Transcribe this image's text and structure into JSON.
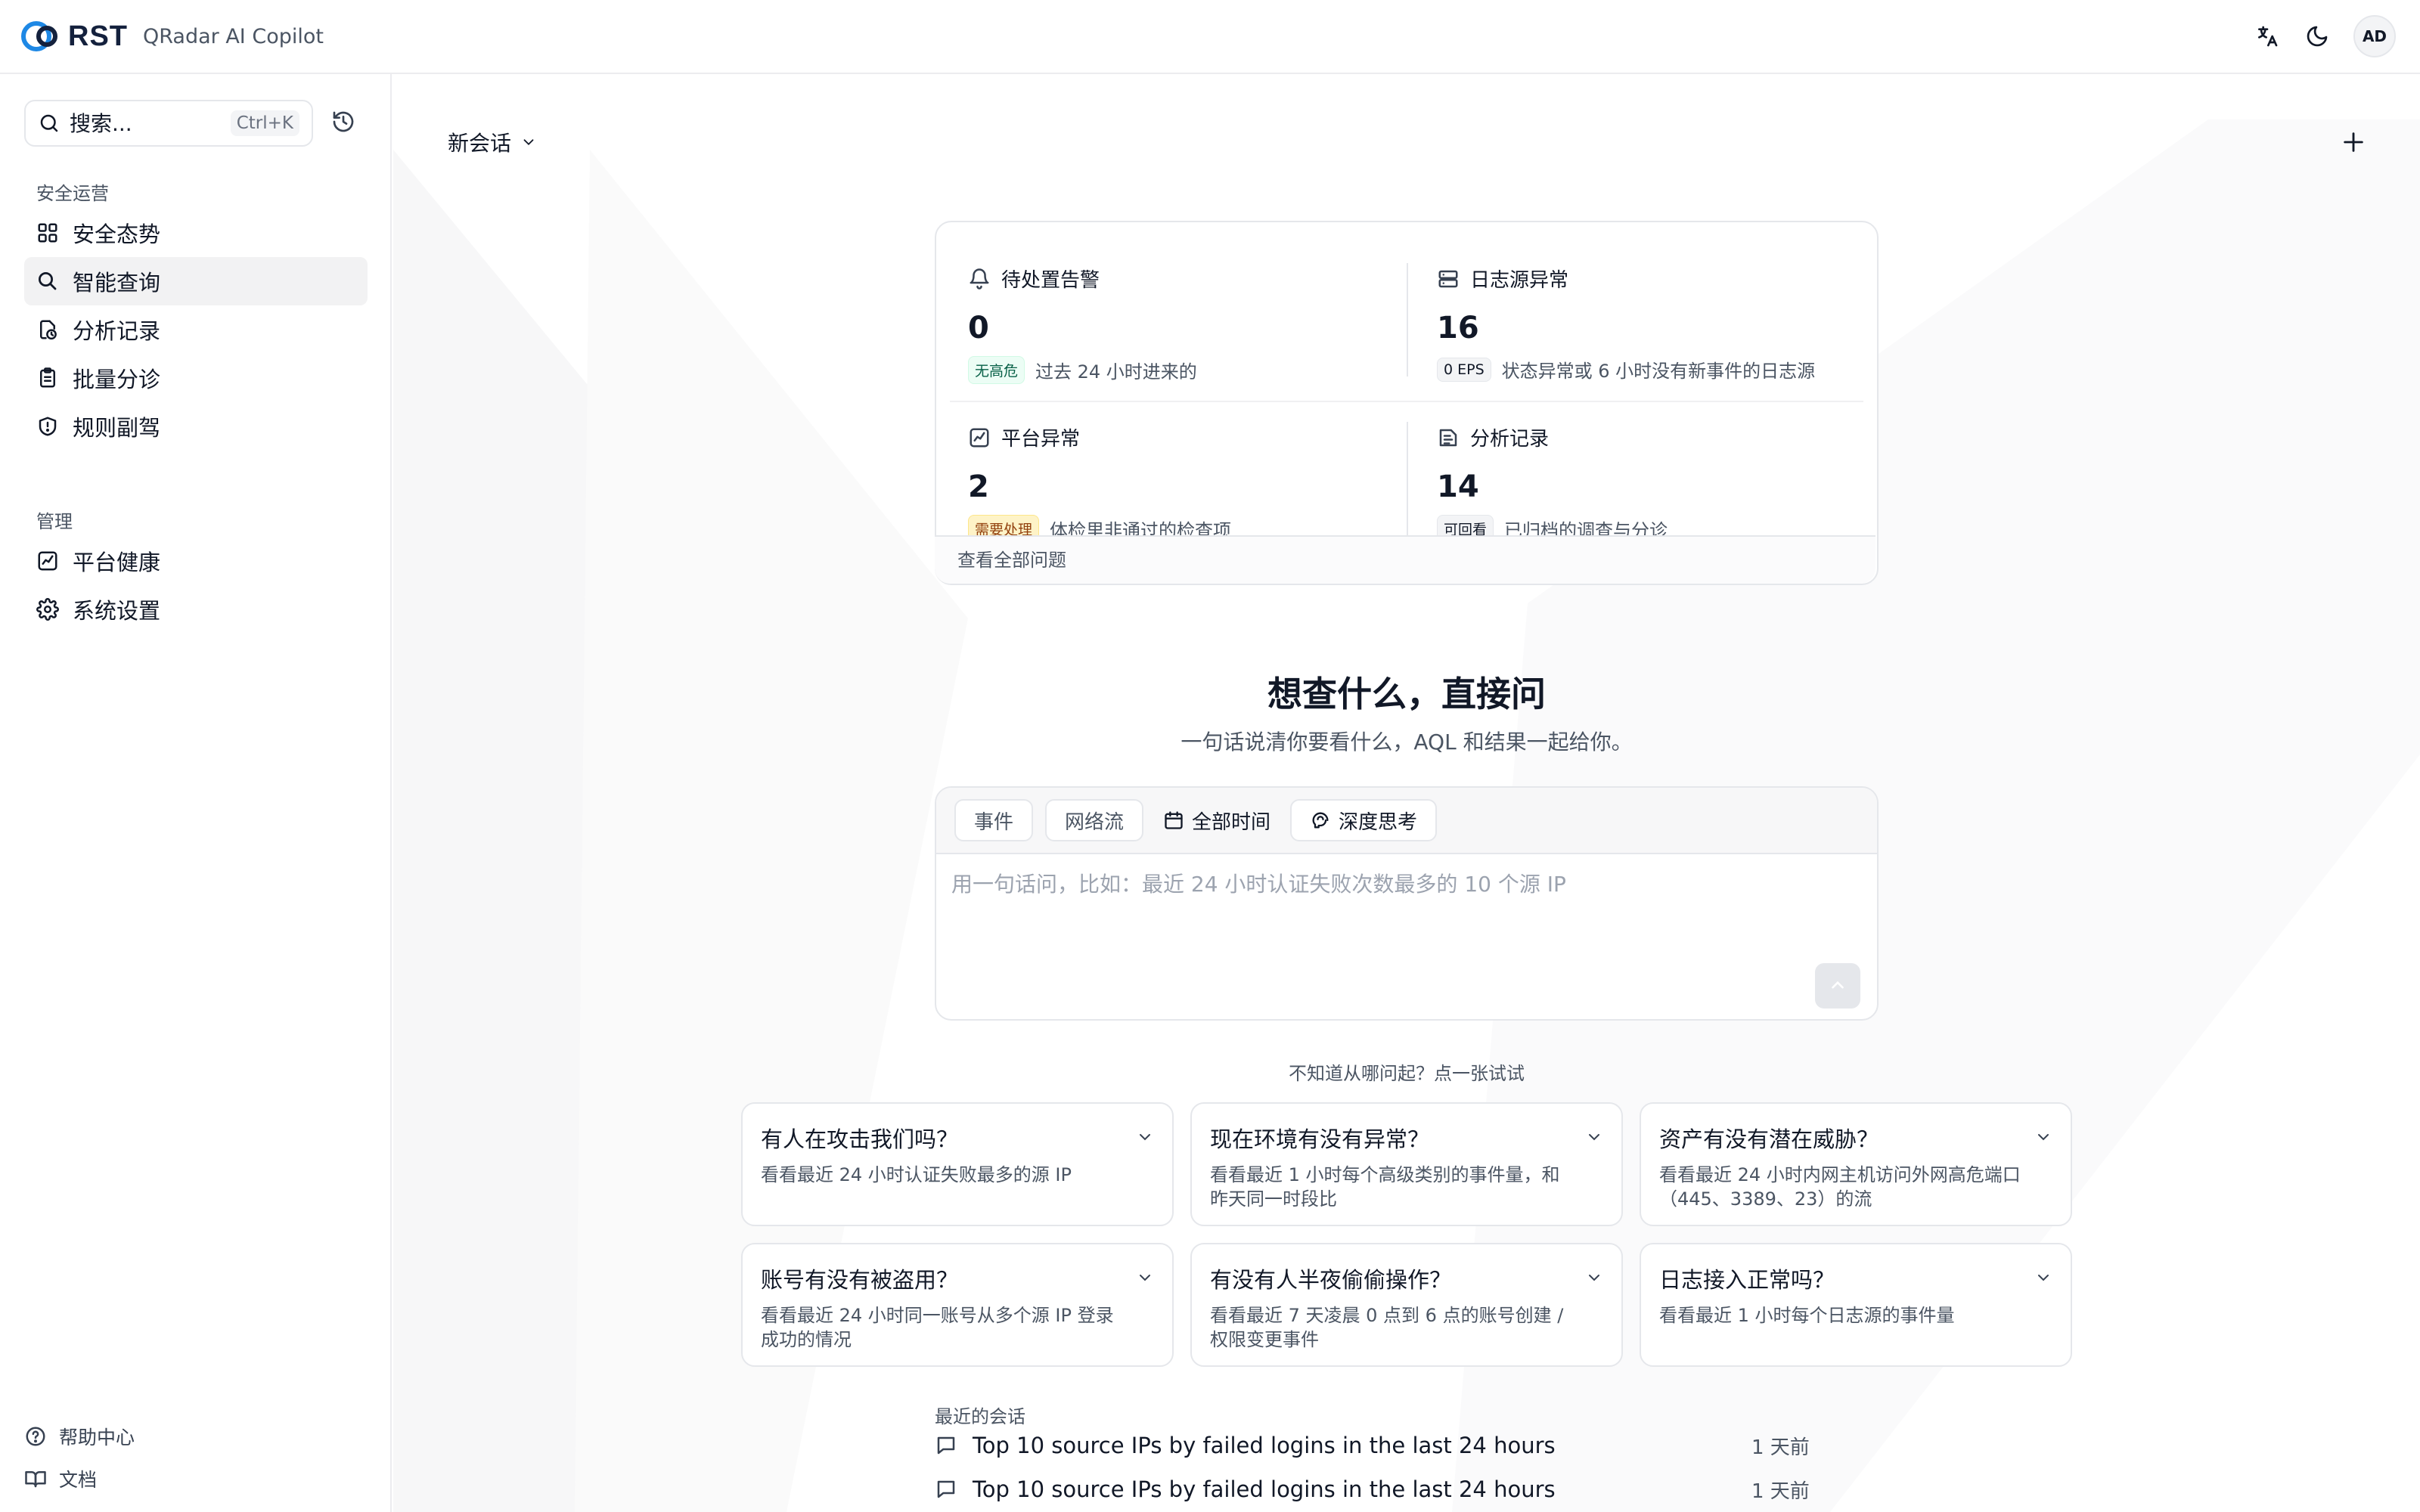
{
  "header": {
    "logo_text": "RST",
    "app_name": "QRadar AI Copilot",
    "avatar_initials": "AD"
  },
  "sidebar": {
    "search_placeholder": "搜索...",
    "search_shortcut": "Ctrl+K",
    "sections": [
      {
        "label": "安全运营",
        "items": [
          {
            "label": "安全态势",
            "icon": "grid-icon"
          },
          {
            "label": "智能查询",
            "icon": "search-icon"
          },
          {
            "label": "分析记录",
            "icon": "clock-file-icon"
          },
          {
            "label": "批量分诊",
            "icon": "clipboard-icon"
          },
          {
            "label": "规则副驾",
            "icon": "shield-icon"
          }
        ]
      },
      {
        "label": "管理",
        "items": [
          {
            "label": "平台健康",
            "icon": "chart-icon"
          },
          {
            "label": "系统设置",
            "icon": "gear-icon"
          }
        ]
      }
    ],
    "footer": [
      {
        "label": "帮助中心",
        "icon": "help-icon"
      },
      {
        "label": "文档",
        "icon": "book-icon"
      }
    ]
  },
  "main": {
    "chat_title": "新会话",
    "stats": [
      {
        "title": "待处置告警",
        "value": "0",
        "badge": "无高危",
        "desc": "过去 24 小时进来的"
      },
      {
        "title": "日志源异常",
        "value": "16",
        "badge": "0 EPS",
        "desc": "状态异常或 6 小时没有新事件的日志源"
      },
      {
        "title": "平台异常",
        "value": "2",
        "badge": "需要处理",
        "desc": "体检里非通过的检查项"
      },
      {
        "title": "分析记录",
        "value": "14",
        "badge": "可回看",
        "desc": "已归档的调查与分诊"
      }
    ],
    "view_all": "查看全部问题",
    "hero_title": "想查什么，直接问",
    "hero_subtitle": "一句话说清你要看什么，AQL 和结果一起给你。",
    "composer": {
      "chips": [
        "事件",
        "网络流",
        "全部时间",
        "深度思考"
      ],
      "placeholder": "用一句话问，比如：最近 24 小时认证失败次数最多的 10 个源 IP"
    },
    "try_label": "不知道从哪问起？点一张试试",
    "suggestions": [
      {
        "title": "有人在攻击我们吗？",
        "desc": "看看最近 24 小时认证失败最多的源 IP"
      },
      {
        "title": "现在环境有没有异常？",
        "desc": "看看最近 1 小时每个高级类别的事件量，和昨天同一时段比"
      },
      {
        "title": "资产有没有潜在威胁？",
        "desc": "看看最近 24 小时内网主机访问外网高危端口（445、3389、23）的流"
      },
      {
        "title": "账号有没有被盗用？",
        "desc": "看看最近 24 小时同一账号从多个源 IP 登录成功的情况"
      },
      {
        "title": "有没有人半夜偷偷操作？",
        "desc": "看看最近 7 天凌晨 0 点到 6 点的账号创建 / 权限变更事件"
      },
      {
        "title": "日志接入正常吗？",
        "desc": "看看最近 1 小时每个日志源的事件量"
      }
    ],
    "recent_label": "最近的会话",
    "recent": [
      {
        "title": "Top 10 source IPs by failed logins in the last 24 hours",
        "time": "1 天前"
      },
      {
        "title": "Top 10 source IPs by failed logins in the last 24 hours",
        "time": "1 天前"
      }
    ]
  }
}
